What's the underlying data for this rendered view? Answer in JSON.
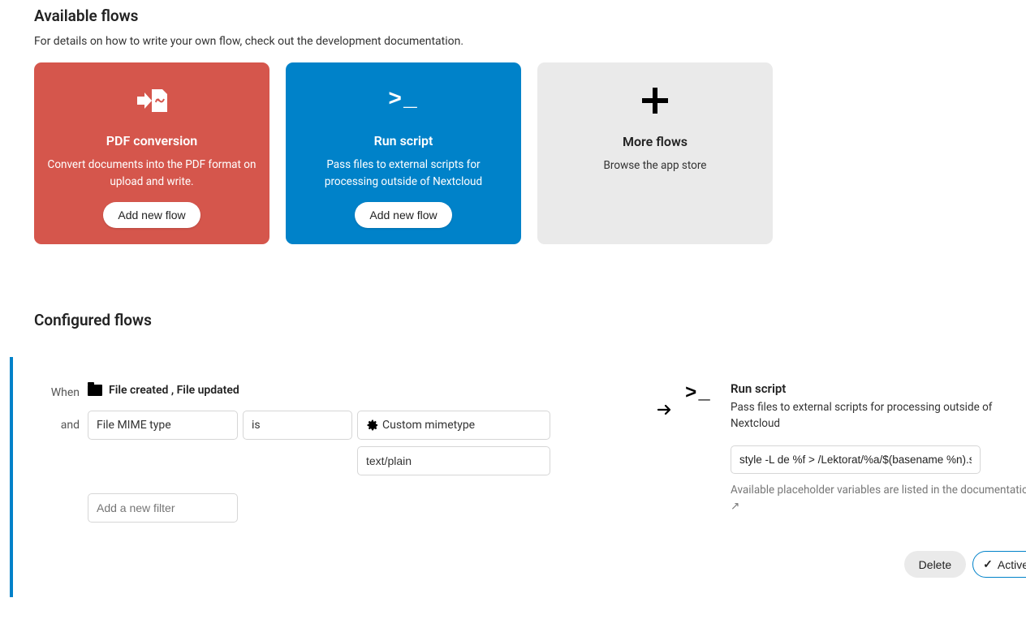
{
  "available": {
    "title": "Available flows",
    "subtitle": "For details on how to write your own flow, check out the development documentation.",
    "cards": [
      {
        "title": "PDF conversion",
        "desc": "Convert documents into the PDF format on upload and write.",
        "cta": "Add new flow"
      },
      {
        "title": "Run script",
        "desc": "Pass files to external scripts for processing outside of Nextcloud",
        "cta": "Add new flow"
      },
      {
        "title": "More flows",
        "desc": "Browse the app store"
      }
    ]
  },
  "configured": {
    "title": "Configured flows"
  },
  "flow": {
    "when_label": "When",
    "and_label": "and",
    "events": "File created ,   File updated",
    "mime_select": "File MIME type",
    "op_select": "is",
    "custom_select": "Custom mimetype",
    "value_input": "text/plain",
    "new_filter_placeholder": "Add a new filter",
    "action": {
      "title": "Run script",
      "desc": "Pass files to external scripts for processing outside of Nextcloud",
      "script_value": "style -L de %f > /Lektorat/%a/$(basename %n).st",
      "help": "Available placeholder variables are listed in the documentation ↗"
    },
    "buttons": {
      "delete": "Delete",
      "active": "Active"
    }
  }
}
